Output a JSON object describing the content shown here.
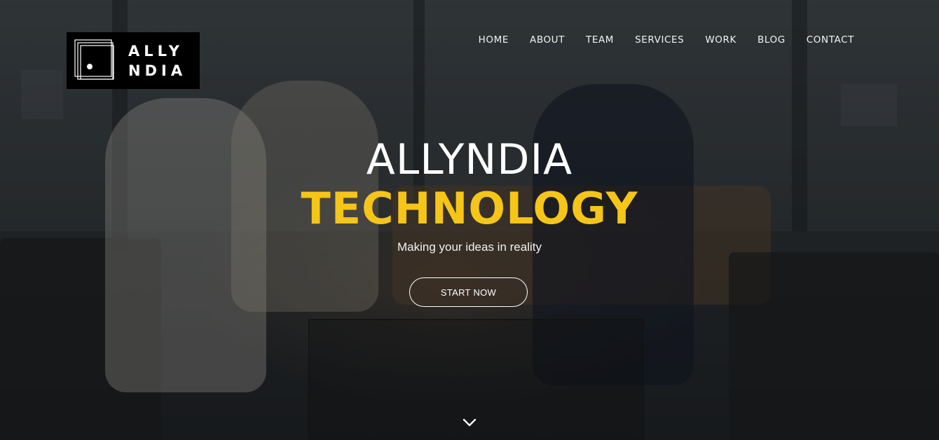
{
  "logo": {
    "line1": "ALLY",
    "line2": "NDIA"
  },
  "nav": {
    "items": [
      {
        "label": "HOME"
      },
      {
        "label": "ABOUT"
      },
      {
        "label": "TEAM"
      },
      {
        "label": "SERVICES"
      },
      {
        "label": "WORK"
      },
      {
        "label": "BLOG"
      },
      {
        "label": "CONTACT"
      }
    ]
  },
  "hero": {
    "title_line1": "ALLYNDIA",
    "title_line2": "TECHNOLOGY",
    "tagline": "Making your ideas in reality",
    "cta_label": "START NOW",
    "scroll_icon": "chevron-down-icon"
  },
  "colors": {
    "accent": "#f5c518",
    "text": "#ffffff",
    "logo_bg": "#000000"
  }
}
